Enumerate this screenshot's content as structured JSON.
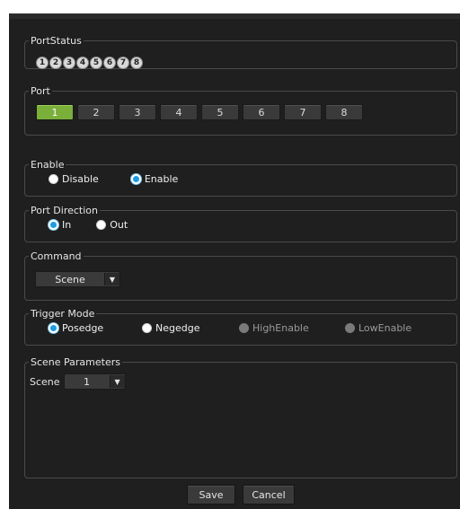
{
  "port_status": {
    "legend": "PortStatus",
    "badges": [
      "1",
      "2",
      "3",
      "4",
      "5",
      "6",
      "7",
      "8"
    ]
  },
  "port": {
    "legend": "Port",
    "buttons": [
      "1",
      "2",
      "3",
      "4",
      "5",
      "6",
      "7",
      "8"
    ],
    "selected": "1",
    "selected_color": "#7ab03a"
  },
  "enable": {
    "legend": "Enable",
    "options": [
      {
        "label": "Disable",
        "checked": false
      },
      {
        "label": "Enable",
        "checked": true
      }
    ]
  },
  "port_direction": {
    "legend": "Port Direction",
    "options": [
      {
        "label": "In",
        "checked": true
      },
      {
        "label": "Out",
        "checked": false
      }
    ]
  },
  "command": {
    "legend": "Command",
    "selected": "Scene",
    "arrow_icon": "chevron-down-icon"
  },
  "trigger_mode": {
    "legend": "Trigger Mode",
    "options": [
      {
        "label": "Posedge",
        "checked": true,
        "disabled": false
      },
      {
        "label": "Negedge",
        "checked": false,
        "disabled": false
      },
      {
        "label": "HighEnable",
        "checked": false,
        "disabled": true
      },
      {
        "label": "LowEnable",
        "checked": false,
        "disabled": true
      }
    ]
  },
  "scene_parameters": {
    "legend": "Scene Parameters",
    "scene_label": "Scene",
    "scene_value": "1"
  },
  "actions": {
    "save_label": "Save",
    "cancel_label": "Cancel"
  },
  "colors": {
    "panel_bg": "#1f1f1f",
    "radio_checked": "#1e9be6",
    "border": "#4a4a4a"
  }
}
